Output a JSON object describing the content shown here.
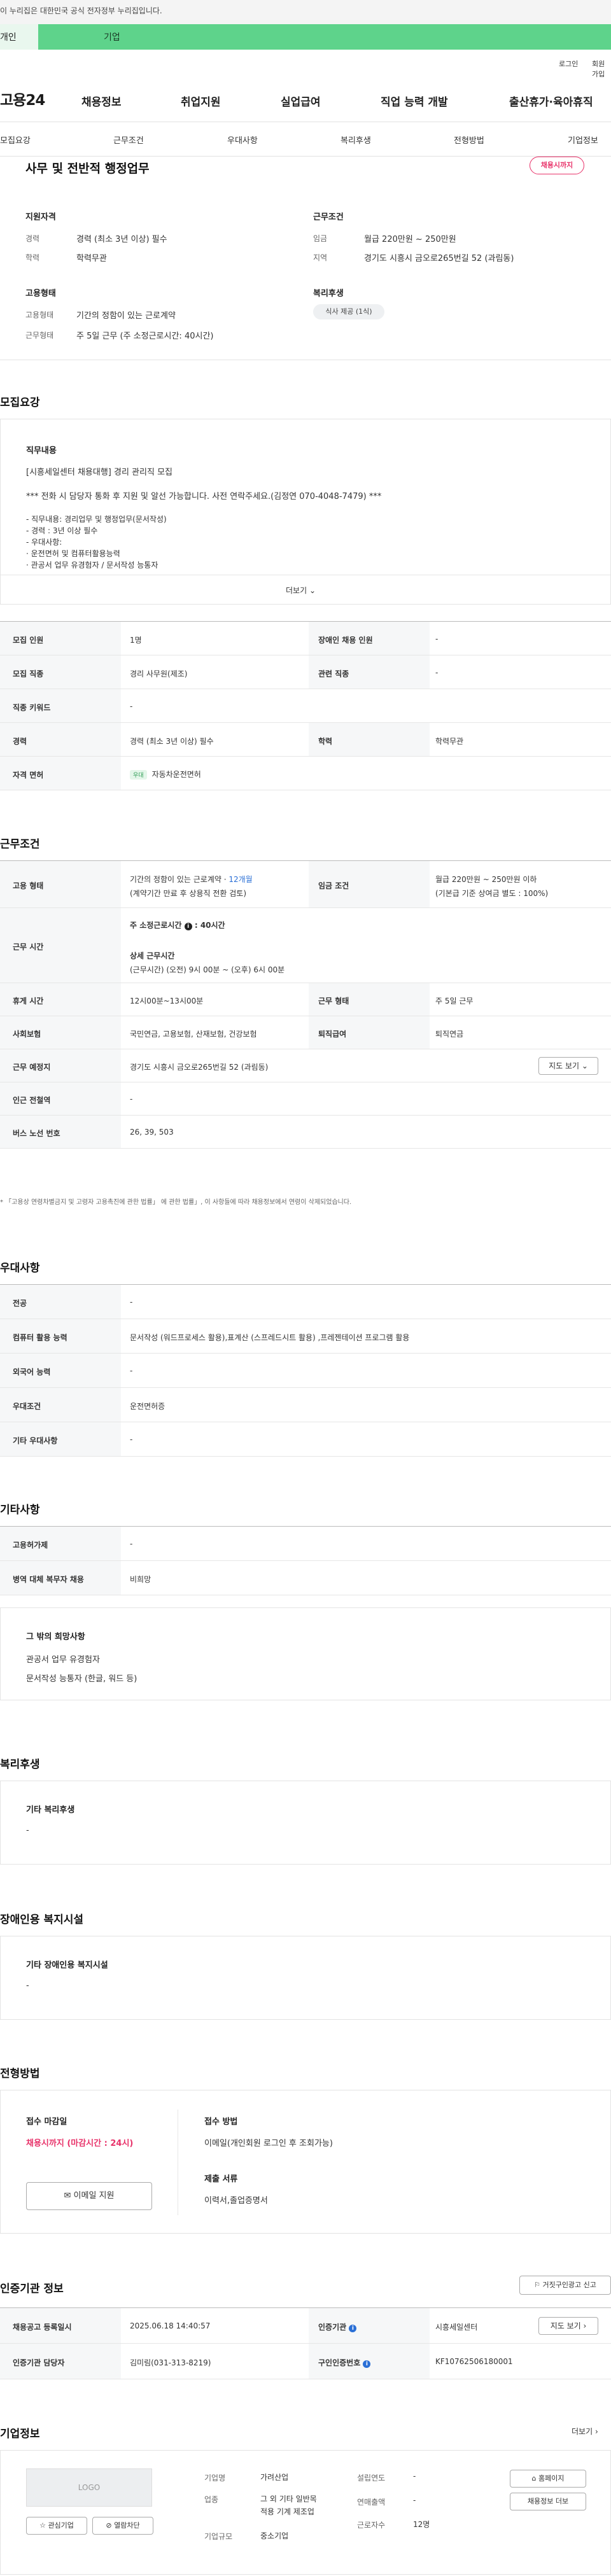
{
  "gov_notice": "이 누리집은 대한민국 공식 전자정부 누리집입니다.",
  "top_tabs": {
    "individual": "개인",
    "company": "기업"
  },
  "util": {
    "login": "로그인",
    "signup": "회원가입"
  },
  "logo": "고용24",
  "gnb": [
    "채용정보",
    "취업지원",
    "실업급여",
    "직업 능력 개발",
    "출산휴가·육아휴직"
  ],
  "subnav": [
    "모집요강",
    "근무조건",
    "우대사항",
    "복리후생",
    "전형방법",
    "기업정보"
  ],
  "summary": {
    "title": "사무 및 전반적 행정업무",
    "status_badge": "채용시까지",
    "qual_title": "지원자격",
    "career_label": "경력",
    "career_value": "경력 (최소 3년 이상) 필수",
    "edu_label": "학력",
    "edu_value": "학력무관",
    "cond_title": "근무조건",
    "wage_label": "임금",
    "wage_value": "월급 220만원 ~ 250만원",
    "area_label": "지역",
    "area_value": "경기도 시흥시 금오로265번길 52 (과림동)",
    "emp_title": "고용형태",
    "emptype_label": "고용형태",
    "emptype_value": "기간의 정함이 있는 근로계약",
    "worktype_label": "근무형태",
    "worktype_value": "주 5일 근무 (주 소정근로시간: 40시간)",
    "welfare_title": "복리후생",
    "welfare_pill": "식사 제공 (1식)"
  },
  "recruit": {
    "heading": "모집요강",
    "job_title": "직무내용",
    "lines": [
      "[시흥세일센터 채용대행] 경리 관리직 모집",
      "*** 전화 시 담당자 통화 후 지원 및 알선 가능합니다. 사전 연락주세요.(김정연 070-4048-7479) ***",
      "- 직무내용: 경리업무 및 행정업무(문서작성)",
      "- 경력 : 3년 이상 필수",
      "- 우대사항:",
      "  · 운전면허 및 컴퓨터활용능력",
      "  · 관공서 업무 유경험자 / 문서작성 능통자"
    ],
    "more": "더보기",
    "table": {
      "r1": [
        "모집 인원",
        "1명",
        "장애인 채용 인원",
        "-"
      ],
      "r2": [
        "모집 직종",
        "경리 사무원(제조)",
        "관련 직종",
        "-"
      ],
      "r3": [
        "직종 키워드",
        "-"
      ],
      "r4": [
        "경력",
        "경력 (최소 3년 이상) 필수",
        "학력",
        "학력무관"
      ],
      "r5": [
        "자격 면허",
        "우대",
        "자동차운전면허"
      ]
    }
  },
  "work": {
    "heading": "근무조건",
    "emp_label": "고용 형태",
    "emp_line1": "기간의 정함이 있는 근로계약 · ",
    "emp_months": "12개월",
    "emp_line2": "(계약기간 만료 후 상용직 전환 검토)",
    "wage_label": "임금 조건",
    "wage_line1": "월급 220만원 ~ 250만원 이하",
    "wage_line2": "(기본급 기준 상여금 별도 : 100%)",
    "hours_label": "근무 시간",
    "hours_week_label": "주 소정근로시간",
    "hours_week_value": "40시간",
    "hours_detail_label": "상세 근무시간",
    "hours_detail_value": "(근무시간) (오전) 9시 00분 ~ (오후) 6시 00분",
    "break_label": "휴게 시간",
    "break_value": "12시00분~13시00분",
    "form_label": "근무 형태",
    "form_value": "주 5일 근무",
    "ins_label": "사회보험",
    "ins_value": "국민연금, 고용보험, 산재보험, 건강보험",
    "retire_label": "퇴직급여",
    "retire_value": "퇴직연금",
    "place_label": "근무 예정지",
    "place_value": "경기도 시흥시 금오로265번길 52 (과림동)",
    "map_btn": "지도 보기",
    "subway_label": "인근 전철역",
    "subway_value": "-",
    "bus_label": "버스 노선 번호",
    "bus_value": "26, 39, 503",
    "footnote": "* 「고용상 연령차별금지 및 고령자 고용촉진에 관한 법률」 에 관한 법률」, 이 사항들에 따라 채용정보에서 연령이 삭제되었습니다."
  },
  "pref": {
    "heading": "우대사항",
    "rows": [
      [
        "전공",
        "-"
      ],
      [
        "컴퓨터 활용 능력",
        "문서작성 (워드프로세스 활용),표계산 (스프레드시트 활용) ,프레젠테이션 프로그램 활용"
      ],
      [
        "외국어 능력",
        "-"
      ],
      [
        "우대조건",
        "운전면허증"
      ],
      [
        "기타 우대사항",
        "-"
      ]
    ]
  },
  "etc": {
    "heading": "기타사항",
    "rows": [
      [
        "고용허가제",
        "-"
      ],
      [
        "병역 대체 복무자 채용",
        "비희망"
      ]
    ],
    "wish_title": "그 밖의 희망사항",
    "wish_lines": [
      "관공서 업무 유경험자",
      "문서작성 능통자 (한글, 워드 등)"
    ]
  },
  "welfare": {
    "heading": "복리후생",
    "box_title": "기타 복리후생",
    "box_value": "-"
  },
  "disabled": {
    "heading": "장애인용 복지시설",
    "box_title": "기타 장애인용 복지시설",
    "box_value": "-"
  },
  "apply": {
    "heading": "전형방법",
    "deadline_label": "접수 마감일",
    "deadline_value": "채용시까지 (마감시간 : 24시)",
    "email_btn": "이메일 지원",
    "method_label": "접수 방법",
    "method_value": "이메일(개인회원 로그인 후 조회가능)",
    "docs_label": "제출 서류",
    "docs_value": "이력서,졸업증명서"
  },
  "agency": {
    "heading": "인증기관 정보",
    "report_btn": "거짓구인광고 신고",
    "reg_label": "채용공고 등록일시",
    "reg_value": "2025.06.18 14:40:57",
    "agency_label": "인증기관",
    "agency_value": "시흥세일센터",
    "map_btn": "지도 보기",
    "manager_label": "인증기관 담당자",
    "manager_value": "김미림(031-313-8219)",
    "reqno_label": "구인인증번호",
    "reqno_value": "KF10762506180001"
  },
  "company": {
    "heading": "기업정보",
    "more": "더보기",
    "logo_placeholder": "LOGO",
    "fav_btn": "관심기업",
    "block_btn": "열람차단",
    "name_label": "기업명",
    "name_value": "가려산업",
    "year_label": "설립연도",
    "year_value": "-",
    "industry_label": "업종",
    "industry_value1": "그 외 기타 일반목",
    "industry_value2": "적용 기계 제조업",
    "sales_label": "연매출액",
    "sales_value": "-",
    "size_label": "기업규모",
    "size_value": "중소기업",
    "staff_label": "근로자수",
    "staff_value": "12명",
    "homepage_btn": "홈페이지",
    "jobs_btn": "채용정보 더보"
  }
}
